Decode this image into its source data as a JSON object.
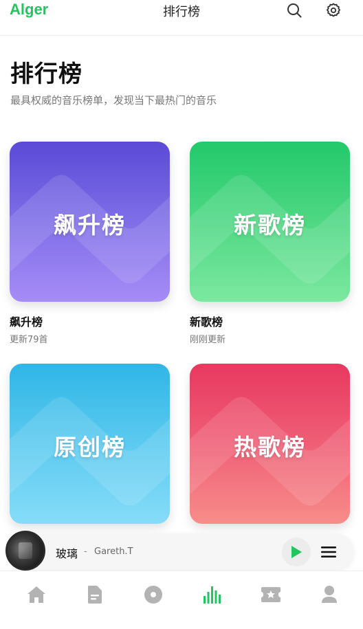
{
  "topbar": {
    "logo": "Alger",
    "title": "排行榜",
    "icons": [
      "search-icon",
      "gear-icon"
    ]
  },
  "header": {
    "title": "排行榜",
    "subtitle": "最具权威的音乐榜单，发现当下最热门的音乐"
  },
  "charts": [
    {
      "label": "飙升榜",
      "name": "飙升榜",
      "meta": "更新79首",
      "color": "#6b5ce0"
    },
    {
      "label": "新歌榜",
      "name": "新歌榜",
      "meta": "刚刚更新",
      "color": "#3fd37a"
    },
    {
      "label": "原创榜",
      "name": "",
      "meta": "",
      "color": "#4cc3ee"
    },
    {
      "label": "热歌榜",
      "name": "",
      "meta": "",
      "color": "#ec4e6c"
    }
  ],
  "player": {
    "title": "玻璃",
    "separator": "-",
    "artist": "Gareth.T",
    "play_color": "#22c55e"
  },
  "bottom_nav": {
    "items": [
      "home-icon",
      "document-icon",
      "disc-icon",
      "chart-icon",
      "ticket-icon",
      "user-icon"
    ],
    "active_index": 3,
    "active_color": "#22c55e",
    "inactive_color": "#b3b3b3"
  }
}
